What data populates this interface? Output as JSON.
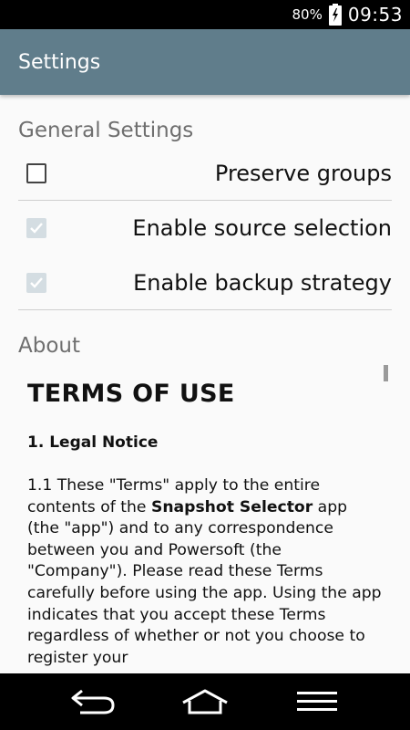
{
  "status_bar": {
    "battery_percent": "80%",
    "battery_icon": "battery-charging-icon",
    "time": "09:53"
  },
  "app_bar": {
    "title": "Settings"
  },
  "general_settings": {
    "header": "General Settings",
    "items": [
      {
        "label": "Preserve groups",
        "checked": false,
        "enabled": true
      },
      {
        "label": "Enable source selection",
        "checked": true,
        "enabled": false
      },
      {
        "label": "Enable backup strategy",
        "checked": true,
        "enabled": false
      }
    ]
  },
  "about": {
    "header": "About",
    "terms_title": "TERMS OF USE",
    "section_title": "1. Legal Notice",
    "paragraph_prefix": "1.1 These \"Terms\" apply to the entire contents of the ",
    "app_name": "Snapshot Selector",
    "paragraph_suffix": " app (the \"app\") and to any correspondence between you and Powersoft (the \"Company\"). Please read these Terms carefully before using the app. Using the app indicates that you accept these Terms regardless of whether or not you choose to register your"
  },
  "nav_bar": {
    "back_icon": "back-icon",
    "home_icon": "home-icon",
    "menu_icon": "menu-icon"
  },
  "colors": {
    "app_bar": "#607d8b",
    "status_bar": "#000000",
    "section_header": "#6f6f6f",
    "checkbox_disabled": "#d4dde2"
  }
}
